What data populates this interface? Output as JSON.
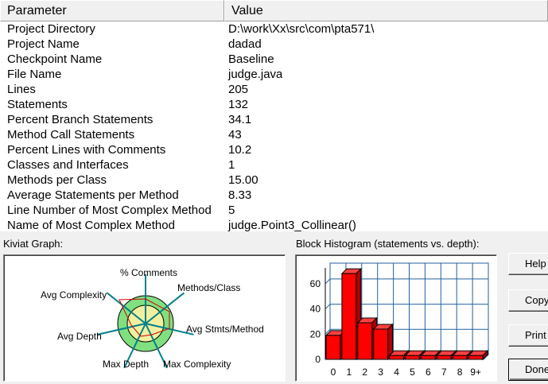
{
  "table": {
    "headers": {
      "parameter": "Parameter",
      "value": "Value"
    },
    "rows": [
      {
        "param": "Project Directory",
        "value": "D:\\work\\Xx\\src\\com\\pta571\\"
      },
      {
        "param": "Project Name",
        "value": "dadad"
      },
      {
        "param": "Checkpoint Name",
        "value": "Baseline"
      },
      {
        "param": "File Name",
        "value": "judge.java"
      },
      {
        "param": "Lines",
        "value": "205"
      },
      {
        "param": "Statements",
        "value": "132"
      },
      {
        "param": "Percent Branch Statements",
        "value": "34.1"
      },
      {
        "param": "Method Call Statements",
        "value": "43"
      },
      {
        "param": "Percent Lines with Comments",
        "value": "10.2"
      },
      {
        "param": "Classes and Interfaces",
        "value": "1"
      },
      {
        "param": "Methods per Class",
        "value": "15.00"
      },
      {
        "param": "Average Statements per Method",
        "value": "8.33"
      },
      {
        "param": "Line Number of Most Complex Method",
        "value": "5"
      },
      {
        "param": "Name of Most Complex Method",
        "value": "judge.Point3_Collinear()"
      }
    ]
  },
  "kiviat": {
    "section_label": "Kiviat Graph:",
    "axis_labels": {
      "comments": "% Comments",
      "methods_class": "Methods/Class",
      "avg_stmts": "Avg Stmts/Method",
      "max_complexity": "Max Complexity",
      "max_depth": "Max Depth",
      "avg_depth": "Avg Depth",
      "avg_complexity": "Avg Complexity"
    },
    "colors": {
      "outer_band": "#80e080",
      "inner_band": "#f0f0a0",
      "axis": "#00808a",
      "polygon": "#d00000"
    }
  },
  "histogram": {
    "section_label": "Block Histogram (statements vs. depth):",
    "chart_data": {
      "type": "bar",
      "categories": [
        "0",
        "1",
        "2",
        "3",
        "4",
        "5",
        "6",
        "7",
        "8",
        "9+"
      ],
      "values": [
        19,
        68,
        29,
        24,
        3,
        3,
        3,
        3,
        3,
        3
      ],
      "y_ticks": [
        "0",
        "20",
        "40",
        "60"
      ],
      "ylim": [
        0,
        70
      ],
      "grid": true,
      "bar_color": "#ff0000",
      "grid_color": "#2060a0"
    }
  },
  "buttons": {
    "help": "Help",
    "copy": "Copy",
    "print": "Print",
    "done": "Done"
  }
}
